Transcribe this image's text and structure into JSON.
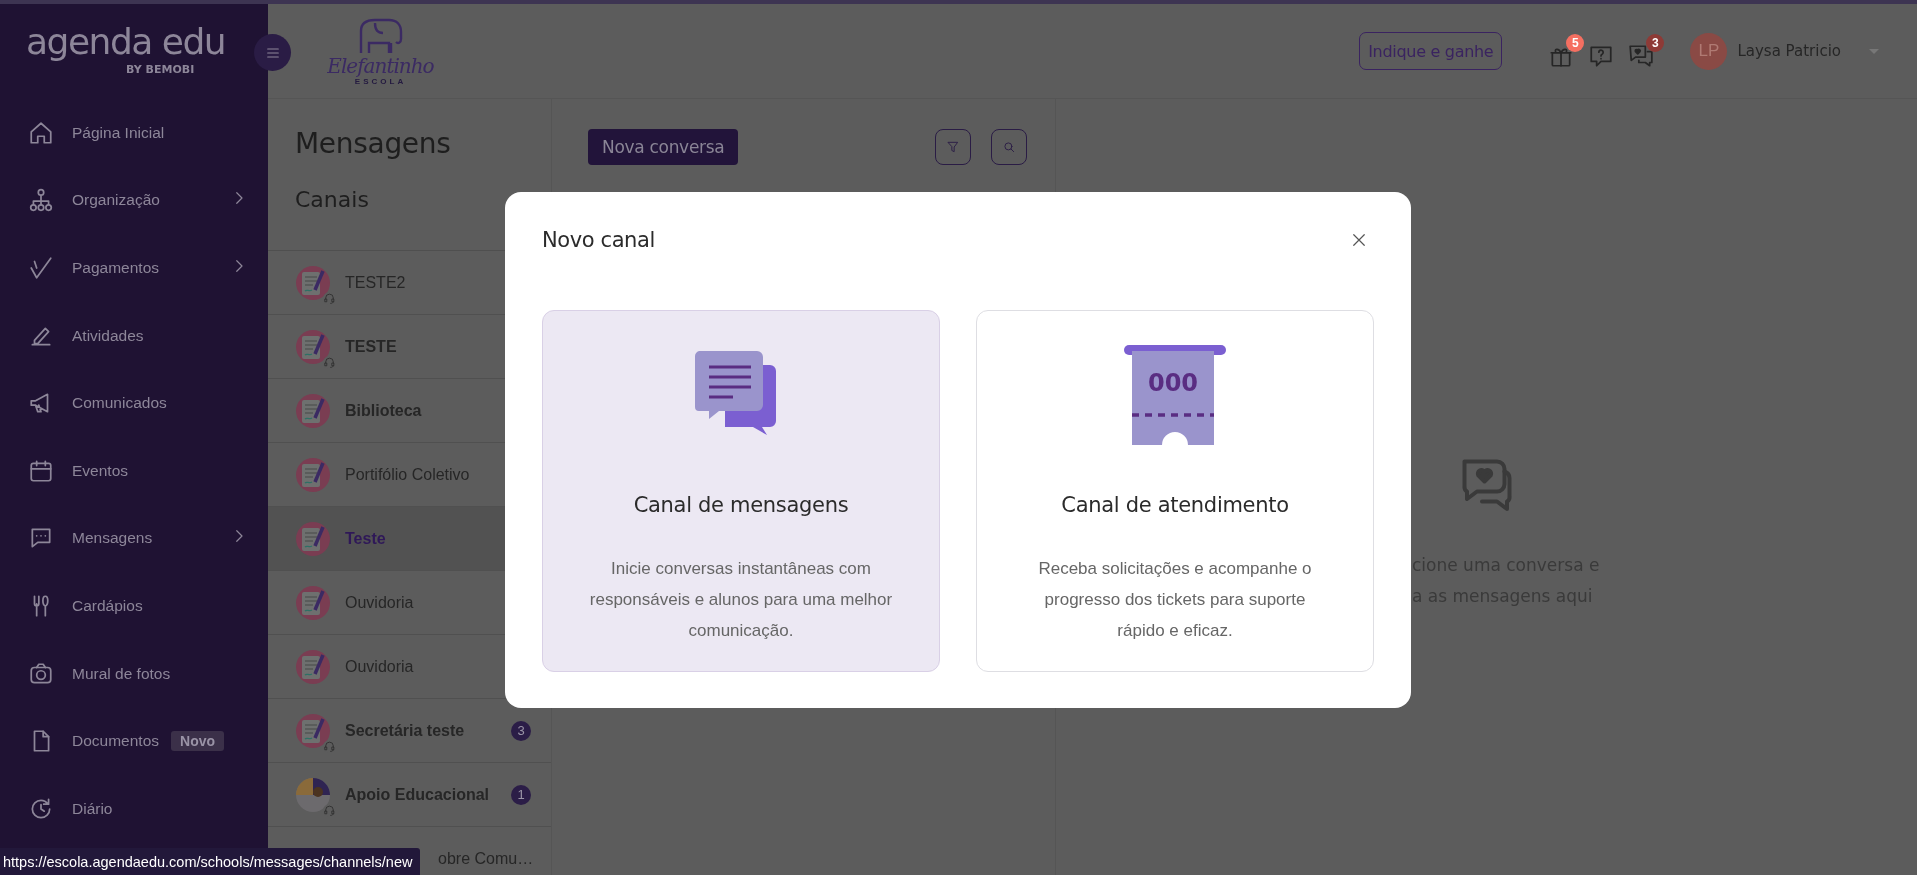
{
  "sidebar": {
    "logo": "agenda edu",
    "logo_sub": "BY BEMOBI",
    "items": [
      {
        "label": "Página Inicial",
        "has_submenu": false
      },
      {
        "label": "Organização",
        "has_submenu": true
      },
      {
        "label": "Pagamentos",
        "has_submenu": true
      },
      {
        "label": "Atividades",
        "has_submenu": false
      },
      {
        "label": "Comunicados",
        "has_submenu": false
      },
      {
        "label": "Eventos",
        "has_submenu": false
      },
      {
        "label": "Mensagens",
        "has_submenu": true
      },
      {
        "label": "Cardápios",
        "has_submenu": false
      },
      {
        "label": "Mural de fotos",
        "has_submenu": false
      },
      {
        "label": "Documentos",
        "has_submenu": false,
        "badge": "Novo"
      },
      {
        "label": "Diário",
        "has_submenu": false
      }
    ]
  },
  "header": {
    "school_logo": "Elefantinho",
    "school_logo_sub": "ESCOLA",
    "refer_button": "Indique e ganhe",
    "notifications": [
      {
        "kind": "gift",
        "badge": "5",
        "color": "#f56f61"
      },
      {
        "kind": "help"
      },
      {
        "kind": "chat",
        "badge": "3",
        "color": "#8e3a36"
      }
    ],
    "user": {
      "initials": "LP",
      "name": "Laysa Patricio"
    }
  },
  "channels": {
    "title": "Mensagens",
    "subtitle": "Canais",
    "items": [
      {
        "name": "TESTE2",
        "kind": "document",
        "support": true,
        "unread": false,
        "selected": false
      },
      {
        "name": "TESTE",
        "kind": "document",
        "support": true,
        "unread": true,
        "selected": false
      },
      {
        "name": "Biblioteca",
        "kind": "document",
        "support": false,
        "unread": true,
        "selected": false
      },
      {
        "name": "Portifólio Coletivo",
        "kind": "document",
        "support": false,
        "unread": false,
        "selected": false
      },
      {
        "name": "Teste",
        "kind": "document",
        "support": false,
        "unread": false,
        "selected": true
      },
      {
        "name": "Ouvidoria",
        "kind": "document",
        "support": false,
        "unread": false,
        "selected": false
      },
      {
        "name": "Ouvidoria",
        "kind": "document",
        "support": false,
        "unread": false,
        "selected": false
      },
      {
        "name": "Secretária teste",
        "kind": "document",
        "support": true,
        "unread": true,
        "selected": false,
        "badge": "3"
      },
      {
        "name": "Apoio Educacional",
        "kind": "people",
        "support": true,
        "unread": true,
        "selected": false,
        "badge": "1"
      },
      {
        "name": "obre Comu…",
        "kind": "hidden",
        "unread": false,
        "selected": false
      }
    ]
  },
  "conversations": {
    "new_button": "Nova conversa"
  },
  "empty_state": {
    "lines": [
      "cione uma conversa e",
      "a as mensagens aqui"
    ]
  },
  "modal": {
    "title": "Novo canal",
    "options": [
      {
        "kind": "messages",
        "title": "Canal de mensagens",
        "description": "Inicie conversas instantâneas com responsáveis e alunos para uma melhor comunicação.",
        "selected": true
      },
      {
        "kind": "service",
        "ticket_number": "000",
        "title": "Canal de atendimento",
        "description": "Receba solicitações e acompanhe o progresso dos tickets para suporte rápido e eficaz.",
        "selected": false
      }
    ]
  },
  "status_url": "https://escola.agendaedu.com/schools/messages/channels/new"
}
